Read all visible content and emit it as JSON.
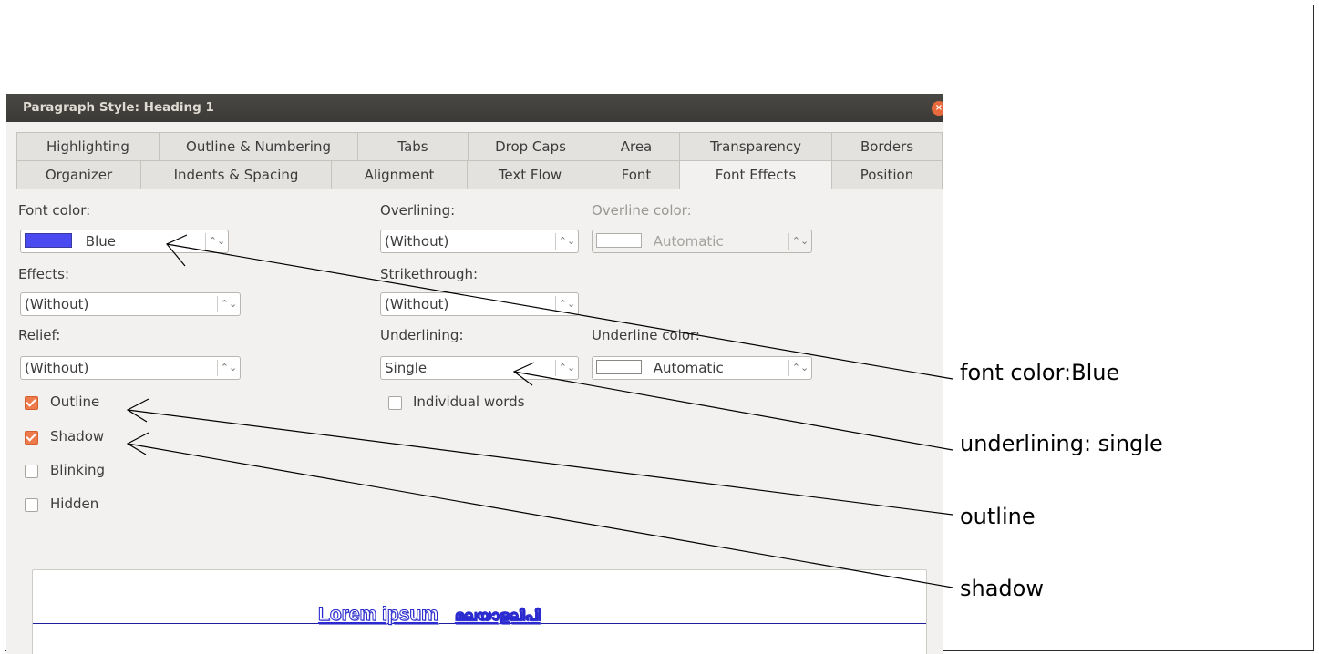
{
  "dialog": {
    "title": "Paragraph Style: Heading 1",
    "close_glyph": "×"
  },
  "tabs_row1": [
    "Highlighting",
    "Outline & Numbering",
    "Tabs",
    "Drop Caps",
    "Area",
    "Transparency",
    "Borders"
  ],
  "tabs_row2": [
    "Organizer",
    "Indents & Spacing",
    "Alignment",
    "Text Flow",
    "Font",
    "Font Effects",
    "Position"
  ],
  "active_tab": "Font Effects",
  "font_effects": {
    "font_color_label": "Font color:",
    "font_color_value": "Blue",
    "font_color_hex": "#4a4af0",
    "effects_label": "Effects:",
    "effects_value": "(Without)",
    "relief_label": "Relief:",
    "relief_value": "(Without)",
    "overlining_label": "Overlining:",
    "overlining_value": "(Without)",
    "overline_color_label": "Overline color:",
    "overline_color_value": "Automatic",
    "strikethrough_label": "Strikethrough:",
    "strikethrough_value": "(Without)",
    "underlining_label": "Underlining:",
    "underlining_value": "Single",
    "underline_color_label": "Underline color:",
    "underline_color_value": "Automatic",
    "individual_words_label": "Individual words",
    "individual_words_checked": false,
    "outline_label": "Outline",
    "outline_checked": true,
    "shadow_label": "Shadow",
    "shadow_checked": true,
    "blinking_label": "Blinking",
    "blinking_checked": false,
    "hidden_label": "Hidden",
    "hidden_checked": false
  },
  "preview": {
    "latin_text": "Lorem ipsum",
    "malayalam_text": "മലയാളലിപി"
  },
  "callouts": [
    "font color:Blue",
    "underlining: single",
    "outline",
    "shadow"
  ],
  "colors": {
    "titlebar_bg": "#3d3b37",
    "dialog_bg": "#f2f1f0",
    "checkbox_accent": "#ef7b4c",
    "preview_blue": "#2a2ad0"
  }
}
